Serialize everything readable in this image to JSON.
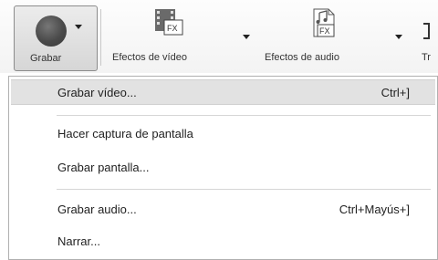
{
  "ribbon": {
    "record_label": "Grabar",
    "video_effects_label": "Efectos de vídeo",
    "audio_effects_label": "Efectos de audio",
    "truncated_label": "Tr",
    "fx_text": "FX"
  },
  "menu": {
    "items": [
      {
        "label": "Grabar vídeo...",
        "shortcut": "Ctrl+]"
      },
      {
        "label": "Hacer captura de pantalla",
        "shortcut": ""
      },
      {
        "label": "Grabar pantalla...",
        "shortcut": ""
      },
      {
        "label": "Grabar audio...",
        "shortcut": "Ctrl+Mayús+]"
      },
      {
        "label": "Narrar...",
        "shortcut": ""
      }
    ]
  }
}
